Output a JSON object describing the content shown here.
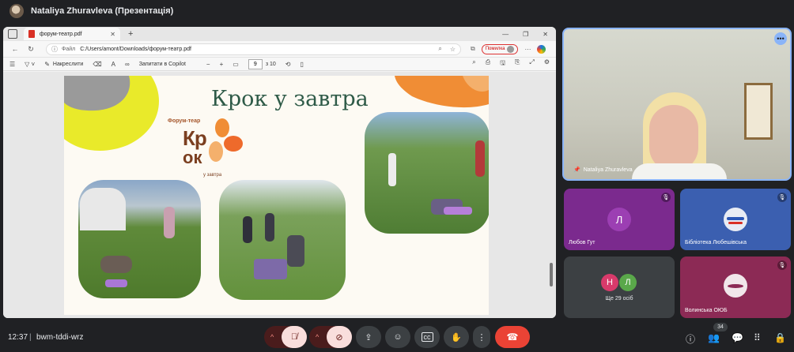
{
  "meeting": {
    "presenter_title": "Nataliya Zhuravleva (Презентація)",
    "time": "12:37",
    "separator": "|",
    "code": "bwm-tddi-wrz",
    "participant_count": "34"
  },
  "browser": {
    "tab_title": "форум-театр.pdf",
    "new_tab": "+",
    "url_prefix": "Файл",
    "url_path": "C:/Users/amont/Downloads/форум-театр.pdf",
    "error_label": "Помилка"
  },
  "pdf_toolbar": {
    "draw_label": "Накреслити",
    "copilot_label": "Запитати в Copilot",
    "page_current": "9",
    "page_total": "з 10"
  },
  "slide": {
    "title": "Крок у завтра",
    "forum_label": "Форум-теар",
    "logo_line1": "Кр",
    "logo_line2": "ок",
    "logo_sub": "у завтра"
  },
  "participants": {
    "main_name": "Nataliya Zhuravleva",
    "tile1_name": "Любов Гут",
    "tile1_letter": "Л",
    "tile2_name": "Бібліотека Любешівська",
    "more_letters": [
      "Н",
      "Л"
    ],
    "more_label": "Ще 29 осіб",
    "tile4_name": "Волинська ОЮБ"
  },
  "colors": {
    "background": "#202124",
    "end_call": "#ea4335",
    "muted_control": "#f9dedc",
    "slide_title": "#2e5a47",
    "logo": "#7b3f20",
    "speaking_border": "#8ab4f8"
  }
}
